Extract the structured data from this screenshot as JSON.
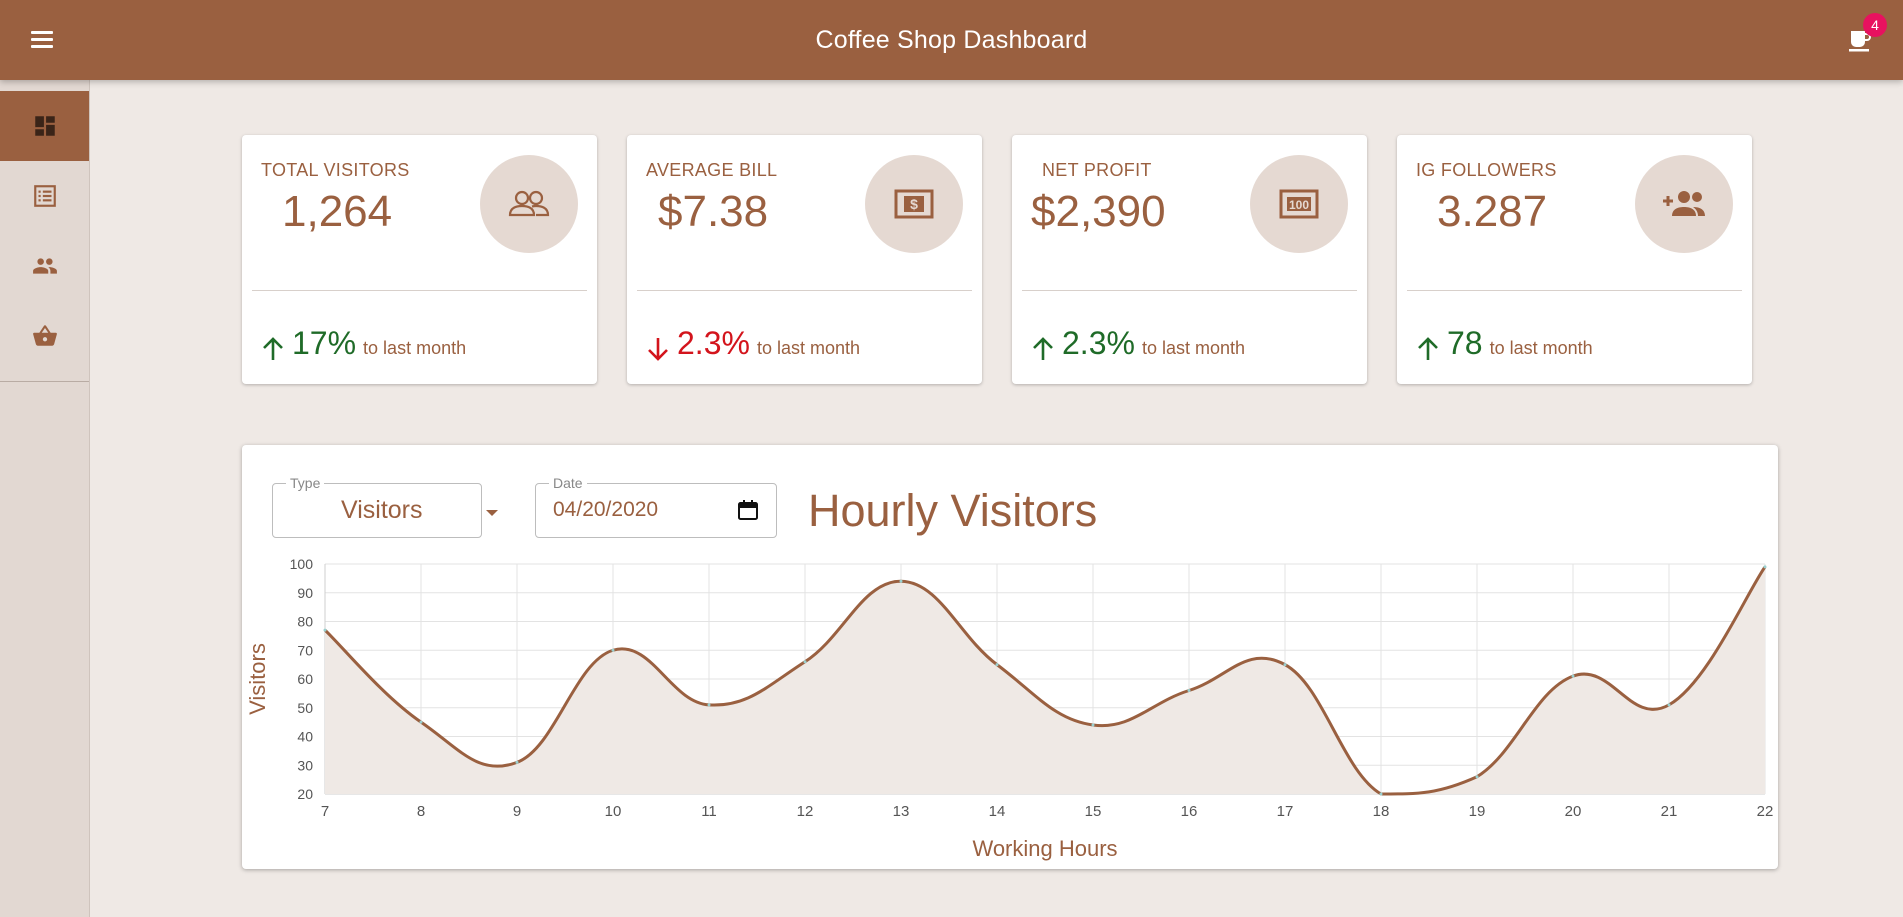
{
  "header": {
    "title": "Coffee Shop Dashboard",
    "cart_badge": "4",
    "menu_icon": "menu-icon",
    "cart_icon": "coffee-cup-icon"
  },
  "sidebar": {
    "items": [
      {
        "name": "dashboard",
        "icon": "dashboard-icon",
        "active": true
      },
      {
        "name": "list",
        "icon": "list-icon",
        "active": false
      },
      {
        "name": "people",
        "icon": "people-icon",
        "active": false
      },
      {
        "name": "basket",
        "icon": "basket-icon",
        "active": false
      }
    ]
  },
  "cards": [
    {
      "label": "TOTAL VISITORS",
      "value": "1,264",
      "change": "17%",
      "trend": "up",
      "suffix": "to last month",
      "icon": "people-outline-icon"
    },
    {
      "label": "AVERAGE BILL",
      "value": "$7.38",
      "change": "2.3%",
      "trend": "down",
      "suffix": "to last month",
      "icon": "dollar-bill-icon"
    },
    {
      "label": "NET PROFIT",
      "value": "$2,390",
      "change": "2.3%",
      "trend": "up",
      "suffix": "to last month",
      "icon": "money-icon"
    },
    {
      "label": "IG FOLLOWERS",
      "value": "3.287",
      "change": "78",
      "trend": "up",
      "suffix": "to last month",
      "icon": "add-group-icon"
    }
  ],
  "colors": {
    "brand": "#9a6040",
    "up": "#1f6b28",
    "down": "#d3141c",
    "badge": "#e8115f",
    "chart_fill": "#efe9e5"
  },
  "filters": {
    "type_label": "Type",
    "type_value": "Visitors",
    "date_label": "Date",
    "date_value": "04/20/2020"
  },
  "chart_data": {
    "type": "line",
    "title": "Hourly Visitors",
    "xlabel": "Working Hours",
    "ylabel": "Visitors",
    "x": [
      7,
      8,
      9,
      10,
      11,
      12,
      13,
      14,
      15,
      16,
      17,
      18,
      19,
      20,
      21,
      22
    ],
    "series": [
      {
        "values": [
          77,
          45,
          31,
          70,
          51,
          66,
          94,
          65,
          44,
          56,
          65,
          20,
          26,
          61,
          51,
          99
        ]
      }
    ],
    "xlim": [
      7,
      22
    ],
    "ylim": [
      20,
      100
    ],
    "yticks": [
      20,
      30,
      40,
      50,
      60,
      70,
      80,
      90,
      100
    ],
    "grid": true,
    "area_fill": true
  }
}
